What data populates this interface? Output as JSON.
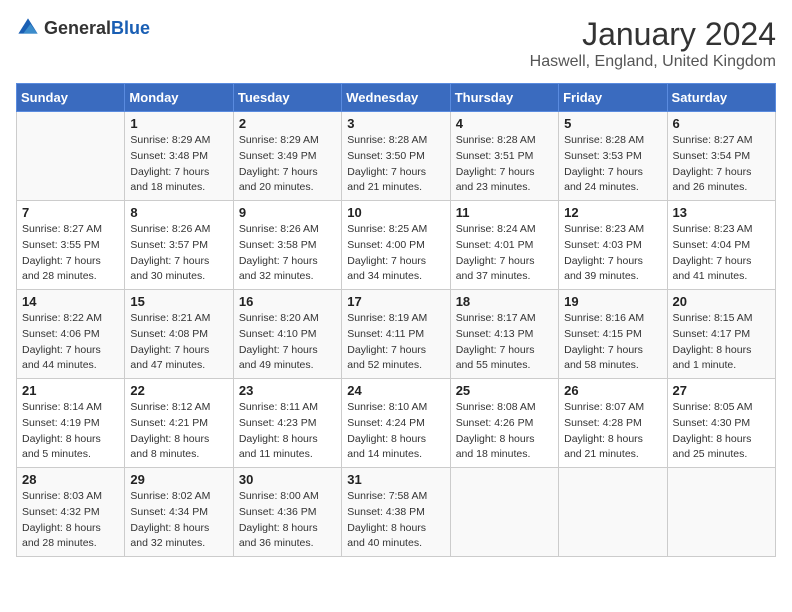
{
  "header": {
    "logo_general": "General",
    "logo_blue": "Blue",
    "month_title": "January 2024",
    "location": "Haswell, England, United Kingdom"
  },
  "days_of_week": [
    "Sunday",
    "Monday",
    "Tuesday",
    "Wednesday",
    "Thursday",
    "Friday",
    "Saturday"
  ],
  "weeks": [
    [
      {
        "day": "",
        "sunrise": "",
        "sunset": "",
        "daylight": ""
      },
      {
        "day": "1",
        "sunrise": "Sunrise: 8:29 AM",
        "sunset": "Sunset: 3:48 PM",
        "daylight": "Daylight: 7 hours and 18 minutes."
      },
      {
        "day": "2",
        "sunrise": "Sunrise: 8:29 AM",
        "sunset": "Sunset: 3:49 PM",
        "daylight": "Daylight: 7 hours and 20 minutes."
      },
      {
        "day": "3",
        "sunrise": "Sunrise: 8:28 AM",
        "sunset": "Sunset: 3:50 PM",
        "daylight": "Daylight: 7 hours and 21 minutes."
      },
      {
        "day": "4",
        "sunrise": "Sunrise: 8:28 AM",
        "sunset": "Sunset: 3:51 PM",
        "daylight": "Daylight: 7 hours and 23 minutes."
      },
      {
        "day": "5",
        "sunrise": "Sunrise: 8:28 AM",
        "sunset": "Sunset: 3:53 PM",
        "daylight": "Daylight: 7 hours and 24 minutes."
      },
      {
        "day": "6",
        "sunrise": "Sunrise: 8:27 AM",
        "sunset": "Sunset: 3:54 PM",
        "daylight": "Daylight: 7 hours and 26 minutes."
      }
    ],
    [
      {
        "day": "7",
        "sunrise": "Sunrise: 8:27 AM",
        "sunset": "Sunset: 3:55 PM",
        "daylight": "Daylight: 7 hours and 28 minutes."
      },
      {
        "day": "8",
        "sunrise": "Sunrise: 8:26 AM",
        "sunset": "Sunset: 3:57 PM",
        "daylight": "Daylight: 7 hours and 30 minutes."
      },
      {
        "day": "9",
        "sunrise": "Sunrise: 8:26 AM",
        "sunset": "Sunset: 3:58 PM",
        "daylight": "Daylight: 7 hours and 32 minutes."
      },
      {
        "day": "10",
        "sunrise": "Sunrise: 8:25 AM",
        "sunset": "Sunset: 4:00 PM",
        "daylight": "Daylight: 7 hours and 34 minutes."
      },
      {
        "day": "11",
        "sunrise": "Sunrise: 8:24 AM",
        "sunset": "Sunset: 4:01 PM",
        "daylight": "Daylight: 7 hours and 37 minutes."
      },
      {
        "day": "12",
        "sunrise": "Sunrise: 8:23 AM",
        "sunset": "Sunset: 4:03 PM",
        "daylight": "Daylight: 7 hours and 39 minutes."
      },
      {
        "day": "13",
        "sunrise": "Sunrise: 8:23 AM",
        "sunset": "Sunset: 4:04 PM",
        "daylight": "Daylight: 7 hours and 41 minutes."
      }
    ],
    [
      {
        "day": "14",
        "sunrise": "Sunrise: 8:22 AM",
        "sunset": "Sunset: 4:06 PM",
        "daylight": "Daylight: 7 hours and 44 minutes."
      },
      {
        "day": "15",
        "sunrise": "Sunrise: 8:21 AM",
        "sunset": "Sunset: 4:08 PM",
        "daylight": "Daylight: 7 hours and 47 minutes."
      },
      {
        "day": "16",
        "sunrise": "Sunrise: 8:20 AM",
        "sunset": "Sunset: 4:10 PM",
        "daylight": "Daylight: 7 hours and 49 minutes."
      },
      {
        "day": "17",
        "sunrise": "Sunrise: 8:19 AM",
        "sunset": "Sunset: 4:11 PM",
        "daylight": "Daylight: 7 hours and 52 minutes."
      },
      {
        "day": "18",
        "sunrise": "Sunrise: 8:17 AM",
        "sunset": "Sunset: 4:13 PM",
        "daylight": "Daylight: 7 hours and 55 minutes."
      },
      {
        "day": "19",
        "sunrise": "Sunrise: 8:16 AM",
        "sunset": "Sunset: 4:15 PM",
        "daylight": "Daylight: 7 hours and 58 minutes."
      },
      {
        "day": "20",
        "sunrise": "Sunrise: 8:15 AM",
        "sunset": "Sunset: 4:17 PM",
        "daylight": "Daylight: 8 hours and 1 minute."
      }
    ],
    [
      {
        "day": "21",
        "sunrise": "Sunrise: 8:14 AM",
        "sunset": "Sunset: 4:19 PM",
        "daylight": "Daylight: 8 hours and 5 minutes."
      },
      {
        "day": "22",
        "sunrise": "Sunrise: 8:12 AM",
        "sunset": "Sunset: 4:21 PM",
        "daylight": "Daylight: 8 hours and 8 minutes."
      },
      {
        "day": "23",
        "sunrise": "Sunrise: 8:11 AM",
        "sunset": "Sunset: 4:23 PM",
        "daylight": "Daylight: 8 hours and 11 minutes."
      },
      {
        "day": "24",
        "sunrise": "Sunrise: 8:10 AM",
        "sunset": "Sunset: 4:24 PM",
        "daylight": "Daylight: 8 hours and 14 minutes."
      },
      {
        "day": "25",
        "sunrise": "Sunrise: 8:08 AM",
        "sunset": "Sunset: 4:26 PM",
        "daylight": "Daylight: 8 hours and 18 minutes."
      },
      {
        "day": "26",
        "sunrise": "Sunrise: 8:07 AM",
        "sunset": "Sunset: 4:28 PM",
        "daylight": "Daylight: 8 hours and 21 minutes."
      },
      {
        "day": "27",
        "sunrise": "Sunrise: 8:05 AM",
        "sunset": "Sunset: 4:30 PM",
        "daylight": "Daylight: 8 hours and 25 minutes."
      }
    ],
    [
      {
        "day": "28",
        "sunrise": "Sunrise: 8:03 AM",
        "sunset": "Sunset: 4:32 PM",
        "daylight": "Daylight: 8 hours and 28 minutes."
      },
      {
        "day": "29",
        "sunrise": "Sunrise: 8:02 AM",
        "sunset": "Sunset: 4:34 PM",
        "daylight": "Daylight: 8 hours and 32 minutes."
      },
      {
        "day": "30",
        "sunrise": "Sunrise: 8:00 AM",
        "sunset": "Sunset: 4:36 PM",
        "daylight": "Daylight: 8 hours and 36 minutes."
      },
      {
        "day": "31",
        "sunrise": "Sunrise: 7:58 AM",
        "sunset": "Sunset: 4:38 PM",
        "daylight": "Daylight: 8 hours and 40 minutes."
      },
      {
        "day": "",
        "sunrise": "",
        "sunset": "",
        "daylight": ""
      },
      {
        "day": "",
        "sunrise": "",
        "sunset": "",
        "daylight": ""
      },
      {
        "day": "",
        "sunrise": "",
        "sunset": "",
        "daylight": ""
      }
    ]
  ]
}
